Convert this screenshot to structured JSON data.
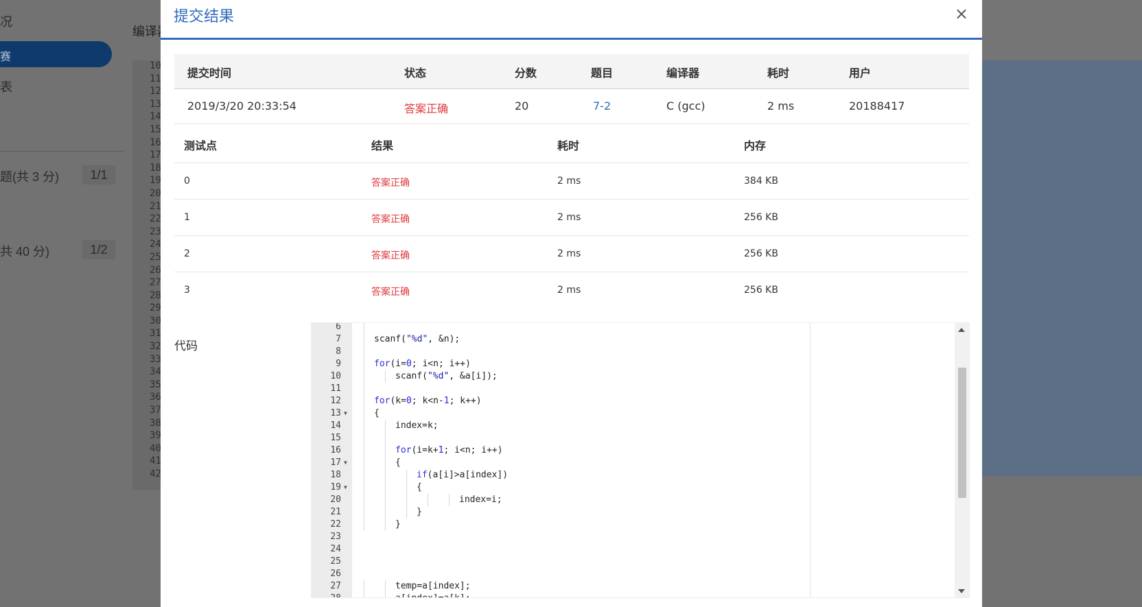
{
  "background": {
    "sidebar_items": [
      "况",
      "赛",
      "表",
      "题(共 3 分)",
      "共 40 分)"
    ],
    "badges": [
      "1/1",
      "1/2"
    ],
    "editor_title": "编译器",
    "gutter_lines": [
      "10",
      "11",
      "12",
      "13",
      "14",
      "15",
      "16",
      "17",
      "18",
      "19",
      "20",
      "21",
      "22",
      "23",
      "24",
      "25",
      "26",
      "27",
      "28",
      "29",
      "30",
      "31",
      "32",
      "33",
      "34",
      "35",
      "36",
      "37",
      "38",
      "39",
      "40",
      "41",
      "42"
    ]
  },
  "modal": {
    "title": "提交结果",
    "close_label": "×"
  },
  "summary": {
    "headers": [
      "提交时间",
      "状态",
      "分数",
      "题目",
      "编译器",
      "耗时",
      "用户"
    ],
    "row": {
      "time": "2019/3/20 20:33:54",
      "status": "答案正确",
      "score": "20",
      "problem": "7-2",
      "compiler": "C (gcc)",
      "duration": "2 ms",
      "user": "20188417"
    }
  },
  "testcases": {
    "headers": [
      "测试点",
      "结果",
      "耗时",
      "内存"
    ],
    "rows": [
      {
        "id": "0",
        "result": "答案正确",
        "time": "2 ms",
        "memory": "384 KB"
      },
      {
        "id": "1",
        "result": "答案正确",
        "time": "2 ms",
        "memory": "256 KB"
      },
      {
        "id": "2",
        "result": "答案正确",
        "time": "2 ms",
        "memory": "256 KB"
      },
      {
        "id": "3",
        "result": "答案正确",
        "time": "2 ms",
        "memory": "256 KB"
      }
    ]
  },
  "code": {
    "label": "代码",
    "lines": [
      {
        "n": "6",
        "fold": false,
        "depth": 1,
        "text": ""
      },
      {
        "n": "7",
        "fold": false,
        "depth": 1,
        "text": "scanf(\"%d\", &n);"
      },
      {
        "n": "8",
        "fold": false,
        "depth": 1,
        "text": ""
      },
      {
        "n": "9",
        "fold": false,
        "depth": 1,
        "text": "for(i=0; i<n; i++)"
      },
      {
        "n": "10",
        "fold": false,
        "depth": 2,
        "text": "scanf(\"%d\", &a[i]);"
      },
      {
        "n": "11",
        "fold": false,
        "depth": 1,
        "text": ""
      },
      {
        "n": "12",
        "fold": false,
        "depth": 1,
        "text": "for(k=0; k<n-1; k++)"
      },
      {
        "n": "13",
        "fold": true,
        "depth": 1,
        "text": "{"
      },
      {
        "n": "14",
        "fold": false,
        "depth": 2,
        "text": "index=k;"
      },
      {
        "n": "15",
        "fold": false,
        "depth": 2,
        "text": ""
      },
      {
        "n": "16",
        "fold": false,
        "depth": 2,
        "text": "for(i=k+1; i<n; i++)"
      },
      {
        "n": "17",
        "fold": true,
        "depth": 2,
        "text": "{"
      },
      {
        "n": "18",
        "fold": false,
        "depth": 3,
        "text": "if(a[i]>a[index])"
      },
      {
        "n": "19",
        "fold": true,
        "depth": 3,
        "text": "{"
      },
      {
        "n": "20",
        "fold": false,
        "depth": 5,
        "text": "index=i;"
      },
      {
        "n": "21",
        "fold": false,
        "depth": 3,
        "text": "}"
      },
      {
        "n": "22",
        "fold": false,
        "depth": 2,
        "text": "}"
      },
      {
        "n": "23",
        "fold": false,
        "depth": 0,
        "text": ""
      },
      {
        "n": "24",
        "fold": false,
        "depth": 0,
        "text": ""
      },
      {
        "n": "25",
        "fold": false,
        "depth": 0,
        "text": ""
      },
      {
        "n": "26",
        "fold": false,
        "depth": 0,
        "text": ""
      },
      {
        "n": "27",
        "fold": false,
        "depth": 2,
        "text": "temp=a[index];"
      },
      {
        "n": "28",
        "fold": false,
        "depth": 2,
        "text": "a[index]=a[k];"
      }
    ]
  }
}
